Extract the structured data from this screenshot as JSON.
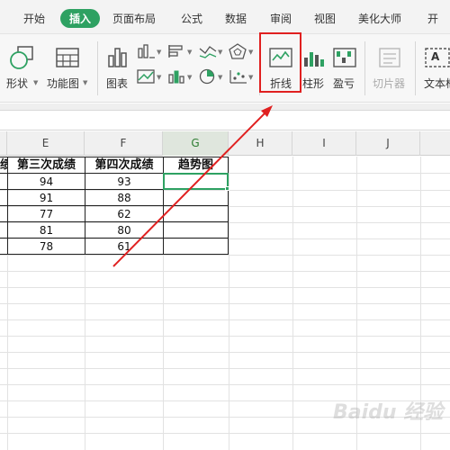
{
  "ribbon_tabs": [
    "开始",
    "插入",
    "页面布局",
    "公式",
    "数据",
    "审阅",
    "视图",
    "美化大师",
    "开"
  ],
  "active_tab": "插入",
  "toolbar": {
    "shapes_label": "形状",
    "function_chart_label": "功能图",
    "chart_label": "图表",
    "line_label": "折线",
    "column_label": "柱形",
    "winloss_label": "盈亏",
    "slicer_label": "切片器",
    "textbox_label": "文本框",
    "textbox_icon_text": "A"
  },
  "columns": [
    "E",
    "F",
    "G",
    "H",
    "I",
    "J"
  ],
  "selected_column": "G",
  "table": {
    "headers": [
      "绩",
      "第三次成绩",
      "第四次成绩",
      "趋势图"
    ],
    "rows": [
      [
        "94",
        "93"
      ],
      [
        "91",
        "88"
      ],
      [
        "77",
        "62"
      ],
      [
        "81",
        "80"
      ],
      [
        "78",
        "61"
      ]
    ]
  },
  "watermark": "Baidu 经验",
  "colors": {
    "accent_green": "#2ea162",
    "highlight_red": "#e02020"
  }
}
